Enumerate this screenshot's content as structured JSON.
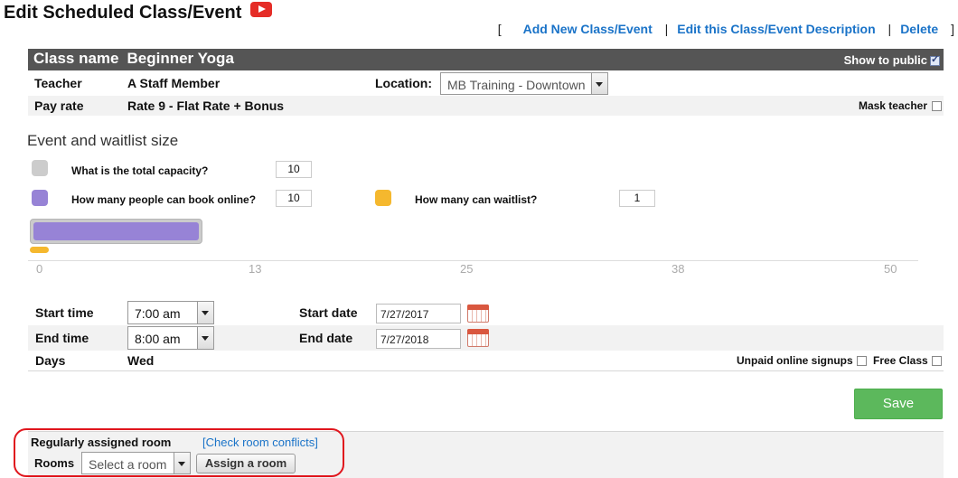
{
  "page": {
    "title": "Edit Scheduled Class/Event",
    "links": {
      "open_bracket": "[",
      "add_new": "Add New Class/Event",
      "edit_description": "Edit this Class/Event Description",
      "delete": "Delete",
      "separator": "|",
      "close_bracket": "]"
    }
  },
  "class_header": {
    "label": "Class name",
    "name": "Beginner Yoga",
    "show_to_public_label": "Show to public",
    "show_to_public_checked": true
  },
  "details": {
    "teacher_label": "Teacher",
    "teacher_value": "A Staff Member",
    "location_label": "Location:",
    "location_value": "MB Training - Downtown",
    "payrate_label": "Pay rate",
    "payrate_value": "Rate 9 - Flat Rate + Bonus",
    "mask_teacher_label": "Mask teacher",
    "mask_teacher_checked": false
  },
  "capacity": {
    "section_title": "Event and waitlist size",
    "total_label": "What is the total capacity?",
    "total_value": "10",
    "online_label": "How many people can book online?",
    "online_value": "10",
    "waitlist_label": "How many can waitlist?",
    "waitlist_value": "1",
    "colors": {
      "total": "#cccccc",
      "online": "#9783d6",
      "waitlist": "#f5b82e"
    },
    "axis_ticks": [
      "0",
      "13",
      "25",
      "38",
      "50"
    ],
    "axis_max": 50,
    "online_fill": 10,
    "waitlist_fill": 1
  },
  "schedule": {
    "start_time_label": "Start time",
    "start_time_value": "7:00 am",
    "start_date_label": "Start date",
    "start_date_value": "7/27/2017",
    "end_time_label": "End time",
    "end_time_value": "8:00 am",
    "end_date_label": "End date",
    "end_date_value": "7/27/2018",
    "days_label": "Days",
    "days_value": "Wed",
    "unpaid_label": "Unpaid online signups",
    "unpaid_checked": false,
    "free_label": "Free Class",
    "free_checked": false
  },
  "actions": {
    "save_label": "Save"
  },
  "rooms": {
    "assigned_label": "Regularly assigned room",
    "check_conflicts_label": "[Check room conflicts]",
    "rooms_label": "Rooms",
    "select_placeholder": "Select a room",
    "assign_label": "Assign a room"
  }
}
